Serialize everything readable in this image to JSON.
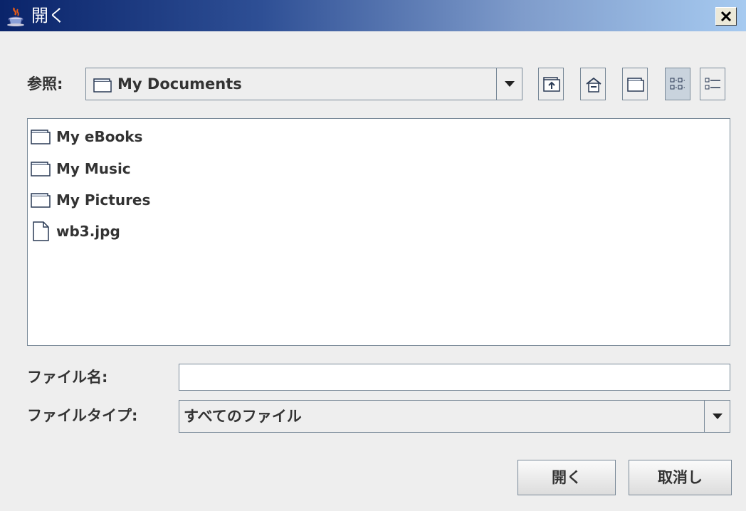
{
  "window": {
    "title": "開く",
    "title_icon": "java-coffee-icon",
    "close_icon": "close-icon"
  },
  "lookin": {
    "label": "参照:",
    "value": "My Documents",
    "icon": "folder-icon"
  },
  "toolbar": [
    {
      "name": "up-one-level-button",
      "icon": "up-folder-icon"
    },
    {
      "name": "home-button",
      "icon": "home-icon"
    },
    {
      "name": "new-folder-button",
      "icon": "new-folder-icon"
    },
    {
      "name": "list-view-button",
      "icon": "list-view-icon",
      "pressed": true
    },
    {
      "name": "details-view-button",
      "icon": "details-view-icon",
      "pressed": false
    }
  ],
  "files": [
    {
      "name": "My eBooks",
      "type": "folder"
    },
    {
      "name": "My Music",
      "type": "folder"
    },
    {
      "name": "My Pictures",
      "type": "folder"
    },
    {
      "name": "wb3.jpg",
      "type": "file"
    }
  ],
  "filename": {
    "label": "ファイル名:",
    "value": ""
  },
  "filetype": {
    "label": "ファイルタイプ:",
    "value": "すべてのファイル"
  },
  "buttons": {
    "open": "開く",
    "cancel": "取消し"
  },
  "colors": {
    "title_gradient_start": "#0a246a",
    "title_gradient_end": "#a6caf0",
    "background": "#eeeeee"
  }
}
